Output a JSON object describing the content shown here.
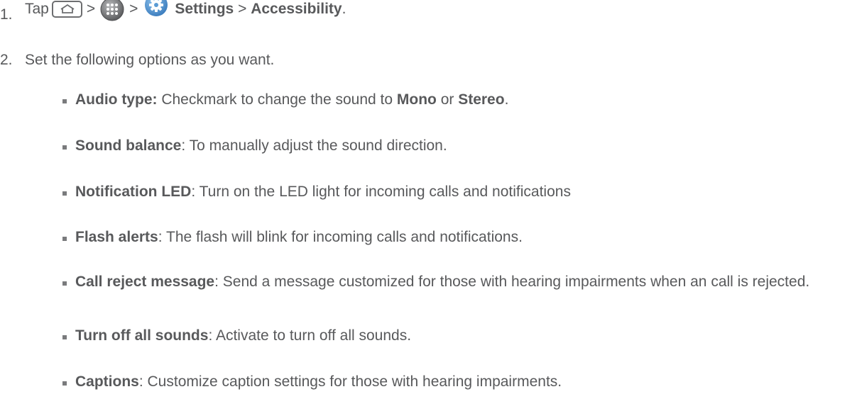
{
  "steps": [
    {
      "number": "1.",
      "tap": "Tap",
      "sep1": ">",
      "sep2": ">",
      "settings": "Settings",
      "sep3": ">",
      "accessibility": "Accessibility",
      "end": ".",
      "icons": [
        "home-key-icon",
        "apps-icon",
        "settings-gear-icon"
      ]
    },
    {
      "number": "2.",
      "text": "Set the following options as you want."
    }
  ],
  "options": [
    {
      "term": "Audio type:",
      "pre": " Checkmark to change the sound to ",
      "bold2": "Mono",
      "mid": " or ",
      "bold3": "Stereo",
      "post": "."
    },
    {
      "term": "Sound balance",
      "desc": ": To manually adjust the sound direction."
    },
    {
      "term": "Notification LED",
      "desc": ": Turn on the LED light for incoming calls and notifications"
    },
    {
      "term": "Flash alerts",
      "desc": ": The flash will blink for incoming calls and notifications."
    },
    {
      "term": "Call reject message",
      "desc": ": Send a message customized for those with hearing impairments when an call is rejected."
    },
    {
      "term": "Turn off all sounds",
      "desc": ": Activate to turn off all sounds."
    },
    {
      "term": "Captions",
      "desc": ": Customize caption settings for those with hearing impairments."
    }
  ],
  "colors": {
    "text": "#58595b",
    "bullet": "#7a7b7d",
    "icon": "#6d6e70",
    "settings_icon": "#5a9bd4"
  }
}
